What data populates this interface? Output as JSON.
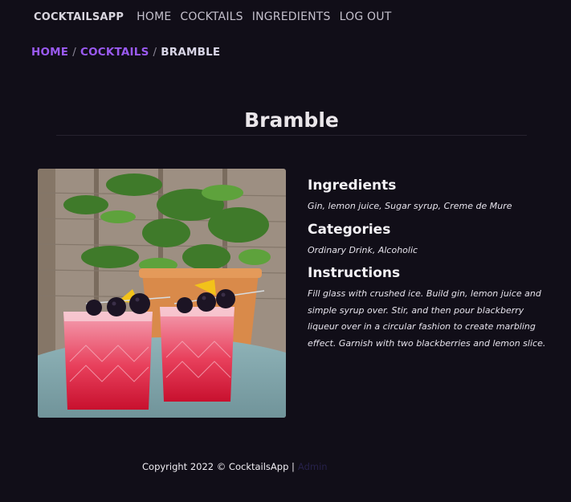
{
  "nav": {
    "brand": "COCKTAILSAPP",
    "links": [
      "HOME",
      "COCKTAILS",
      "INGREDIENTS",
      "LOG OUT"
    ]
  },
  "breadcrumb": {
    "home": "HOME",
    "cocktails": "COCKTAILS",
    "current": "BRAMBLE",
    "separator": "/"
  },
  "cocktail": {
    "name": "Bramble",
    "ingredients_heading": "Ingredients",
    "ingredients": "Gin, lemon juice, Sugar syrup, Creme de Mure",
    "categories_heading": "Categories",
    "categories": "Ordinary Drink, Alcoholic",
    "instructions_heading": "Instructions",
    "instructions": "Fill glass with crushed ice. Build gin, lemon juice and simple syrup over. Stir, and then pour blackberry liqueur over in a circular fashion to create marbling effect. Garnish with two blackberries and lemon slice."
  },
  "footer": {
    "copyright": "Copyright 2022 © CocktailsApp |",
    "admin_link": "Admin"
  },
  "colors": {
    "background": "#110e18",
    "accent": "#9a5af0"
  }
}
